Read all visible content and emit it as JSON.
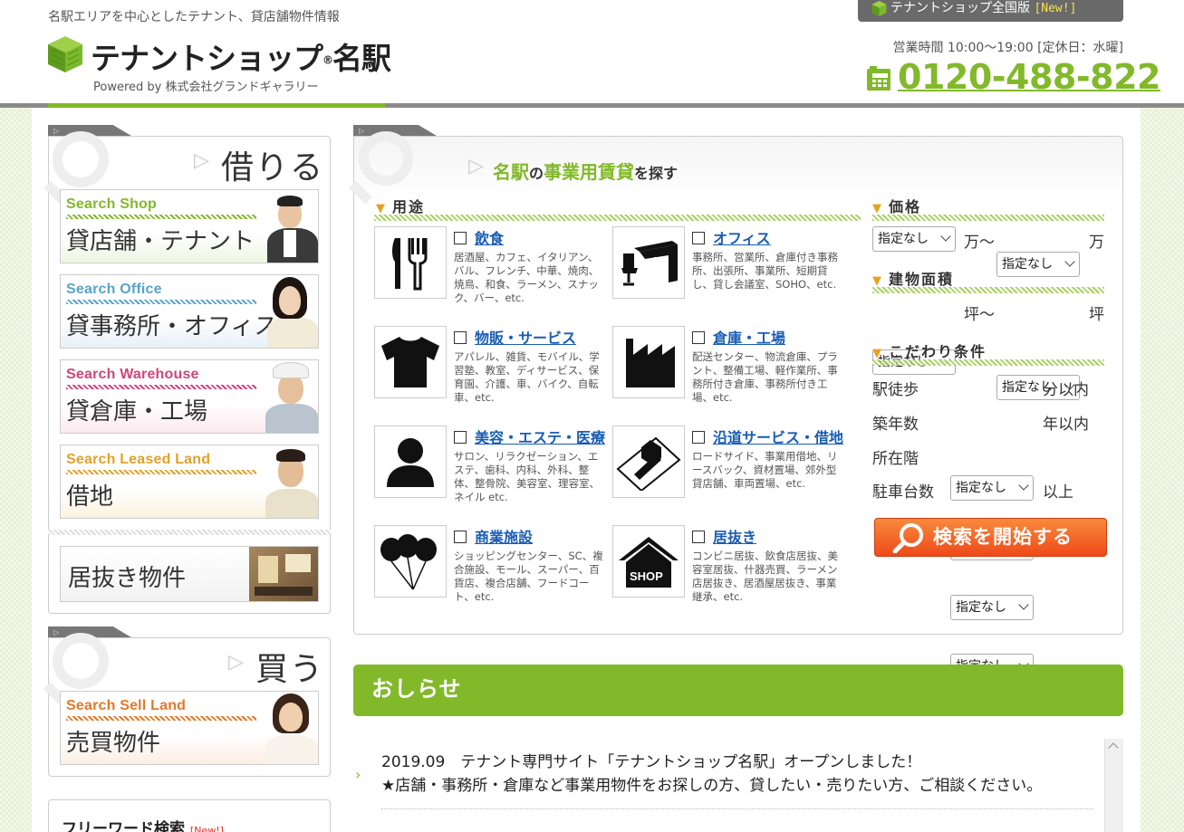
{
  "header": {
    "tagline": "名駅エリアを中心としたテナント、貸店舗物件情報",
    "logo_name": "テナントショップ",
    "logo_reg": "®",
    "logo_station": "名駅",
    "powered_by": "Powered by  株式会社グランドギャラリー",
    "national_label": "テナントショップ全国版",
    "national_new": "[New!]",
    "hours": "営業時間 10:00～19:00 [定休日：水曜]",
    "phone": "0120-488-822"
  },
  "rent_panel": {
    "title": "借りる",
    "cards": [
      {
        "en": "Search Shop",
        "jp": "貸店舗・テナント",
        "color": "#82b92b"
      },
      {
        "en": "Search Office",
        "jp": "貸事務所・オフィス",
        "color": "#5aa3cc"
      },
      {
        "en": "Search Warehouse",
        "jp": "貸倉庫・工場",
        "color": "#d0457a"
      },
      {
        "en": "Search Leased Land",
        "jp": "借地",
        "color": "#e0a22a"
      }
    ],
    "inuki_label": "居抜き物件"
  },
  "buy_panel": {
    "title": "買う",
    "card": {
      "en": "Search Sell Land",
      "jp": "売買物件",
      "color": "#e0792a"
    }
  },
  "free_word": {
    "title": "フリーワード検索",
    "new": "[New!]"
  },
  "search_panel": {
    "title_part1": "名駅",
    "title_part2": "の",
    "title_part3": "事業用賃貸",
    "title_part4": "を探す",
    "usage_heading": "用途",
    "categories": [
      {
        "title": "飲食",
        "desc": "居酒屋、カフェ、イタリアン、バル、フレンチ、中華、焼肉、焼鳥、和食、ラーメン、スナック、バー、etc.",
        "icon": "fork-knife-icon"
      },
      {
        "title": "オフィス",
        "desc": "事務所、営業所、倉庫付き事務所、出張所、事業所、短期貸し、貸し会議室、SOHO、etc.",
        "icon": "office-desk-icon"
      },
      {
        "title": "物販・サービス",
        "desc": "アパレル、雑貨、モバイル、学習塾、教室、ディサービス、保育園、介護、車、バイク、自転車、etc.",
        "icon": "tshirt-icon"
      },
      {
        "title": "倉庫・工場",
        "desc": "配送センター、物流倉庫、プラント、整備工場、軽作業所、事務所付き倉庫、事務所付き工場、etc.",
        "icon": "factory-icon"
      },
      {
        "title": "美容・エステ・医療",
        "desc": "サロン、リラクゼーション、エステ、歯科、内科、外科、整体、整骨院、美容室、理容室、ネイル etc.",
        "icon": "person-icon"
      },
      {
        "title": "沿道サービス・借地",
        "desc": "ロードサイド、事業用借地、リースバック、資材置場、郊外型貸店舗、車両置場、etc.",
        "icon": "roadside-icon"
      },
      {
        "title": "商業施設",
        "desc": "ショッピングセンター、SC、複合施設、モール、スーパー、百貨店、複合店舗、フードコート、etc.",
        "icon": "balloons-icon"
      },
      {
        "title": "居抜き",
        "desc": "コンビニ居抜、飲食店居抜、美容室居抜、什器売買、ラーメン店居抜き、居酒屋居抜き、事業継承、etc.",
        "icon": "shop-house-icon"
      }
    ],
    "shop_label": "SHOP",
    "price_heading": "価格",
    "area_heading": "建物面積",
    "conditions_heading": "こだわり条件",
    "select_default": "指定なし",
    "price_unit_from": "万～",
    "price_unit_to": "万",
    "area_unit_from": "坪～",
    "area_unit_to": "坪",
    "conditions": [
      {
        "label": "駅徒歩",
        "suffix": "分以内"
      },
      {
        "label": "築年数",
        "suffix": "年以内"
      },
      {
        "label": "所在階",
        "suffix": ""
      },
      {
        "label": "駐車台数",
        "suffix": "以上"
      }
    ],
    "search_button": "検索を開始する"
  },
  "news": {
    "heading": "おしらせ",
    "line1": "2019.09　テナント専門サイト「テナントショップ名駅」オープンしました！",
    "line2": "★店舗・事務所・倉庫など事業用物件をお探しの方、貸したい・売りたい方、ご相談ください。"
  }
}
